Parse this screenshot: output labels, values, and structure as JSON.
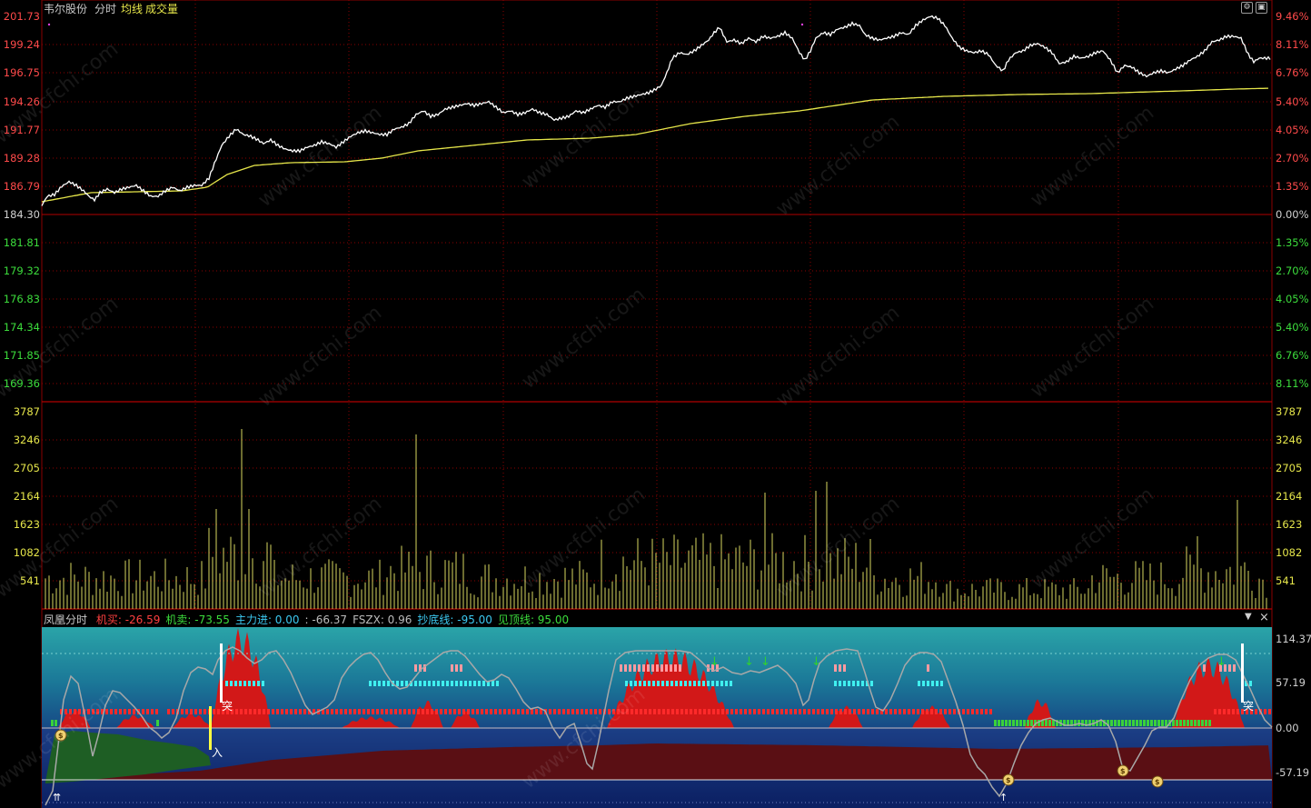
{
  "header": {
    "stock_name": "韦尔股份",
    "mode": "分时",
    "avg_line": "均线",
    "volume": "成交量"
  },
  "price_axis": {
    "left": [
      "201.73",
      "199.24",
      "196.75",
      "194.26",
      "191.77",
      "189.28",
      "186.79",
      "184.30",
      "181.81",
      "179.32",
      "176.83",
      "174.34",
      "171.85",
      "169.36"
    ],
    "right": [
      "9.46%",
      "8.11%",
      "6.76%",
      "5.40%",
      "4.05%",
      "2.70%",
      "1.35%",
      "0.00%",
      "1.35%",
      "2.70%",
      "4.05%",
      "5.40%",
      "6.76%",
      "8.11%"
    ]
  },
  "volume_axis": [
    "3787",
    "3246",
    "2705",
    "2164",
    "1623",
    "1082",
    "541"
  ],
  "indicator": {
    "name": "凤凰分时",
    "items": [
      {
        "label": "机买:",
        "value": "-26.59",
        "color": "#ff4040"
      },
      {
        "label": "机卖:",
        "value": "-73.55",
        "color": "#3cdc3c"
      },
      {
        "label": "主力进:",
        "value": "0.00",
        "color": "#3cc8f0"
      },
      {
        "label": ":",
        "value": "-66.37",
        "color": "#bbbbbb"
      },
      {
        "label": "FSZX:",
        "value": "0.96",
        "color": "#bbbbbb"
      },
      {
        "label": "抄底线:",
        "value": "-95.00",
        "color": "#3cc8f0"
      },
      {
        "label": "见顶线:",
        "value": "95.00",
        "color": "#3cdc3c"
      }
    ],
    "axis": [
      "114.37",
      "57.19",
      "0.00",
      "-57.19"
    ],
    "signals": {
      "tu": "突",
      "ru": "入"
    }
  },
  "watermark": "www.cfchi.com",
  "colors": {
    "bg": "#000000",
    "price_line": "#ffffff",
    "avg_line": "#e6e64a",
    "volume_bar": "#d8d860",
    "up": "#ff3030",
    "down": "#30c030",
    "grid": "#8b0000"
  }
}
